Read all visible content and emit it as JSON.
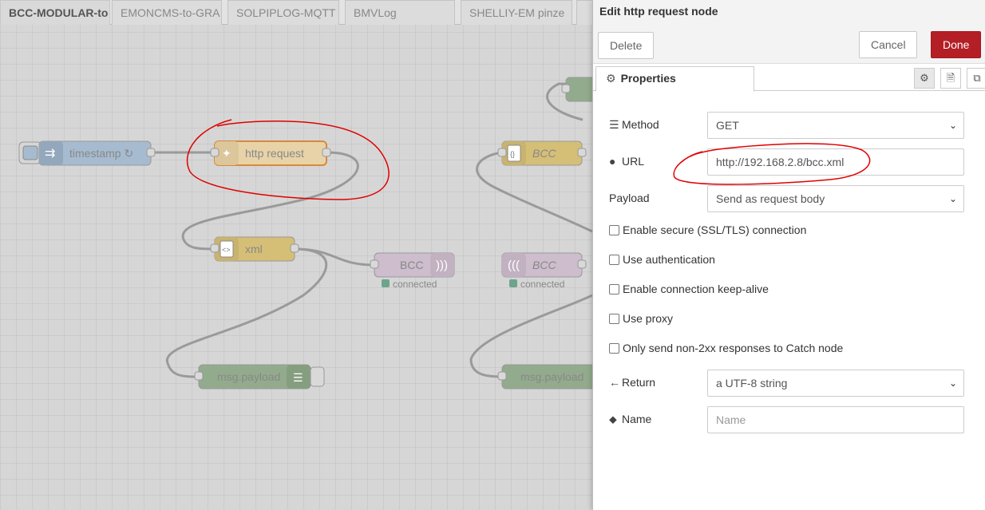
{
  "workspace": {
    "tabs": [
      "BCC-MODULAR-to",
      "EMONCMS-to-GRA",
      "SOLPIPLOG-MQTT",
      "BMVLog",
      "SHELLIY-EM pinze"
    ],
    "nodes": {
      "timestamp": "timestamp ↻",
      "http_request": "http request",
      "xml": "xml",
      "bcc_mqtt_out": "BCC",
      "bcc_mqtt_status": "connected",
      "msg_payload_1": "msg.payload",
      "bcc_function": "BCC",
      "bcc_mqtt_in": "BCC",
      "bcc_mqtt_in_status": "connected",
      "msg_payload_2": "msg.payload"
    },
    "colors": {
      "inject": "#a6bbcf",
      "function": "#fdd0a2",
      "parser": "#debd5c",
      "mqtt": "#d8bfd8",
      "debug": "#87a980",
      "annotation": "#e00000"
    }
  },
  "tray": {
    "title": "Edit http request node",
    "delete_label": "Delete",
    "cancel_label": "Cancel",
    "done_label": "Done",
    "properties_tab": "Properties",
    "method_label": "Method",
    "method_value": "GET",
    "url_label": "URL",
    "url_value": "http://192.168.2.8/bcc.xml",
    "payload_label": "Payload",
    "payload_value": "Send as request body",
    "ssl_label": "Enable secure (SSL/TLS) connection",
    "auth_label": "Use authentication",
    "keepalive_label": "Enable connection keep-alive",
    "proxy_label": "Use proxy",
    "non2xx_label": "Only send non-2xx responses to Catch node",
    "return_label": "Return",
    "return_value": "a UTF-8 string",
    "name_label": "Name",
    "name_placeholder": "Name"
  }
}
